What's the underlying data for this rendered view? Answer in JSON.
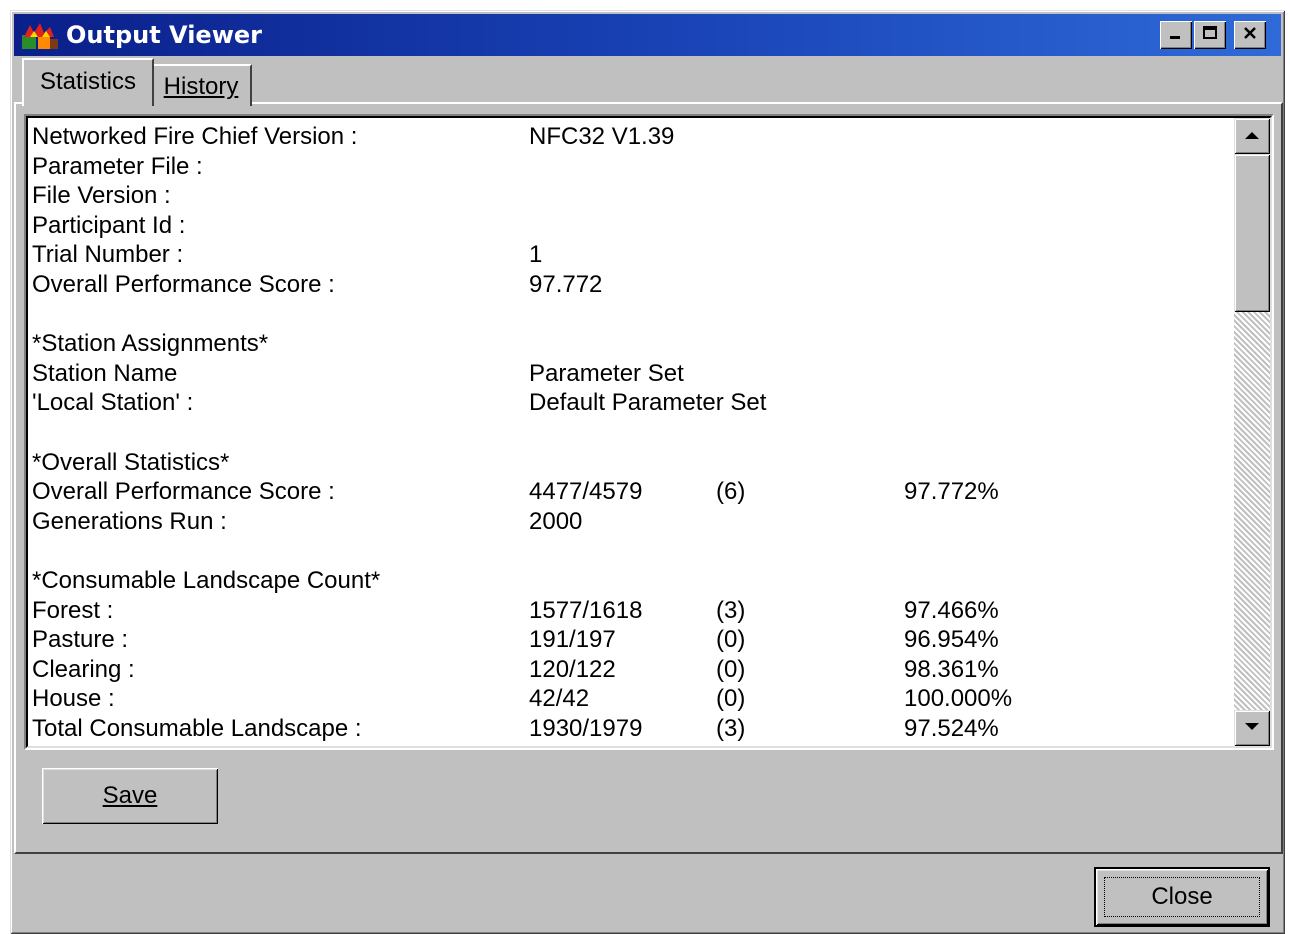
{
  "window": {
    "title": "Output Viewer",
    "icon": "fire-icon"
  },
  "title_buttons": [
    {
      "name": "minimize-icon"
    },
    {
      "name": "maximize-icon"
    },
    {
      "name": "close-icon"
    }
  ],
  "tabs": [
    {
      "label": "Statistics",
      "selected": true
    },
    {
      "label": "History",
      "selected": false
    }
  ],
  "output": {
    "rows": [
      {
        "label": "Networked Fire Chief Version :",
        "value": "NFC32 V1.39",
        "extra": "",
        "percent": ""
      },
      {
        "label": "Parameter File :",
        "value": "",
        "extra": "",
        "percent": ""
      },
      {
        "label": "File Version    :",
        "value": "",
        "extra": "",
        "percent": ""
      },
      {
        "label": "Participant Id :",
        "value": "",
        "extra": "",
        "percent": ""
      },
      {
        "label": "Trial Number :",
        "value": "1",
        "extra": "",
        "percent": ""
      },
      {
        "label": "Overall Performance Score :",
        "value": "97.772",
        "extra": "",
        "percent": ""
      },
      {
        "label": "",
        "value": "",
        "extra": "",
        "percent": ""
      },
      {
        "label": "*Station Assignments*",
        "value": "",
        "extra": "",
        "percent": ""
      },
      {
        "label": "Station Name",
        "value": "Parameter Set",
        "extra": "",
        "percent": ""
      },
      {
        "label": "'Local Station' :",
        "value": "Default Parameter Set",
        "extra": "",
        "percent": ""
      },
      {
        "label": "",
        "value": "",
        "extra": "",
        "percent": ""
      },
      {
        "label": "*Overall Statistics*",
        "value": "",
        "extra": "",
        "percent": ""
      },
      {
        "label": "Overall Performance Score :",
        "value": "4477/4579",
        "extra": "(6)",
        "percent": "97.772%"
      },
      {
        "label": "Generations Run :",
        "value": "2000",
        "extra": "",
        "percent": ""
      },
      {
        "label": "",
        "value": "",
        "extra": "",
        "percent": ""
      },
      {
        "label": "*Consumable Landscape Count*",
        "value": "",
        "extra": "",
        "percent": ""
      },
      {
        "label": "Forest :",
        "value": "1577/1618",
        "extra": "(3)",
        "percent": "97.466%"
      },
      {
        "label": "Pasture :",
        "value": "191/197",
        "extra": "(0)",
        "percent": "96.954%"
      },
      {
        "label": "Clearing :",
        "value": "120/122",
        "extra": "(0)",
        "percent": "98.361%"
      },
      {
        "label": "House :",
        "value": "42/42",
        "extra": "(0)",
        "percent": "100.000%"
      },
      {
        "label": "Total Consumable Landscape :",
        "value": "1930/1979",
        "extra": "(3)",
        "percent": "97.524%"
      }
    ]
  },
  "buttons": {
    "save_label": "Save",
    "close_label": "Close"
  },
  "colors": {
    "face": "#c0c0c0",
    "title_start": "#0a1f8a",
    "title_end": "#2f6ad8",
    "text_bg": "#ffffff"
  }
}
